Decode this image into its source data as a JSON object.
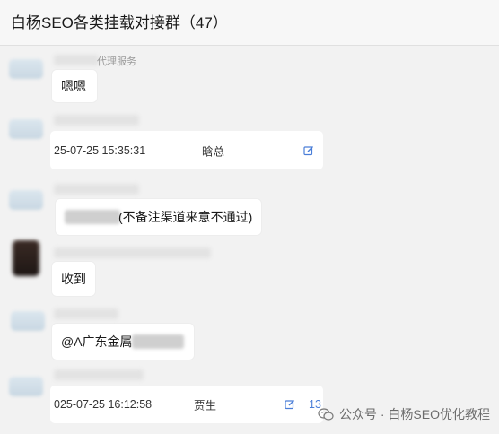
{
  "header": {
    "title": "白杨SEO各类挂载对接群（47）"
  },
  "messages": [
    {
      "sender_suffix": "代理服务",
      "text": "嗯嗯"
    },
    {
      "card": {
        "time": "25-07-25 15:35:31",
        "name": "晗总"
      }
    },
    {
      "text_suffix": "(不备注渠道来意不通过)"
    },
    {
      "text": "收到"
    },
    {
      "text_prefix": "@A广东金属"
    },
    {
      "card": {
        "time": "025-07-25 16:12:58",
        "name": "贾生",
        "count": "13"
      }
    }
  ],
  "watermark": {
    "text": "公众号 · 白杨SEO优化教程"
  },
  "colors": {
    "accent": "#4a7ed8",
    "background": "#f2f2f2",
    "bubble": "#ffffff"
  }
}
